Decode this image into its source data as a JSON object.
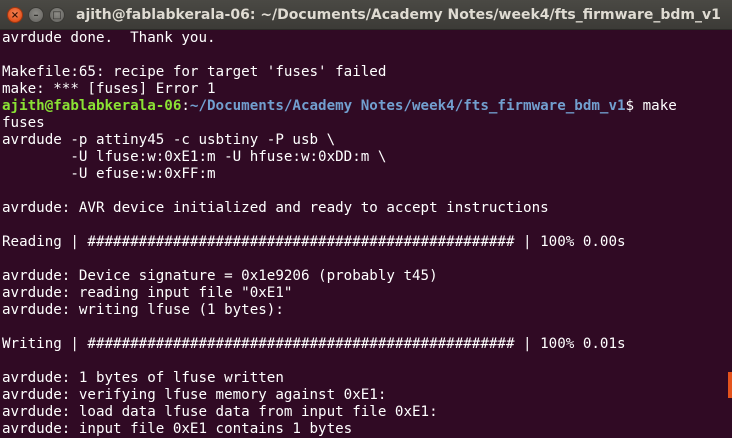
{
  "window": {
    "title": "ajith@fablabkerala-06: ~/Documents/Academy Notes/week4/fts_firmware_bdm_v1",
    "close_glyph": "×",
    "minimize_glyph": "–",
    "maximize_glyph": "□"
  },
  "terminal": {
    "line01": "avrdude done.  Thank you.",
    "line02": "",
    "line03": "Makefile:65: recipe for target 'fuses' failed",
    "line04": "make: *** [fuses] Error 1",
    "prompt_user": "ajith@fablabkerala-06",
    "prompt_sep": ":",
    "prompt_path": "~/Documents/Academy Notes/week4/fts_firmware_bdm_v1",
    "prompt_cmd": "$ make",
    "line06": "fuses",
    "line07": "avrdude -p attiny45 -c usbtiny -P usb \\",
    "line08": "        -U lfuse:w:0xE1:m -U hfuse:w:0xDD:m \\",
    "line09": "        -U efuse:w:0xFF:m",
    "line10": "",
    "line11": "avrdude: AVR device initialized and ready to accept instructions",
    "line12": "",
    "line13": "Reading | ################################################## | 100% 0.00s",
    "line14": "",
    "line15": "avrdude: Device signature = 0x1e9206 (probably t45)",
    "line16": "avrdude: reading input file \"0xE1\"",
    "line17": "avrdude: writing lfuse (1 bytes):",
    "line18": "",
    "line19": "Writing | ################################################## | 100% 0.01s",
    "line20": "",
    "line21": "avrdude: 1 bytes of lfuse written",
    "line22": "avrdude: verifying lfuse memory against 0xE1:",
    "line23": "avrdude: load data lfuse data from input file 0xE1:",
    "line24": "avrdude: input file 0xE1 contains 1 bytes"
  },
  "colors": {
    "background": "#300a24",
    "prompt_user": "#8ae234",
    "prompt_path": "#729fcf",
    "text": "#ffffff",
    "scroll_marker": "#e4531d"
  }
}
